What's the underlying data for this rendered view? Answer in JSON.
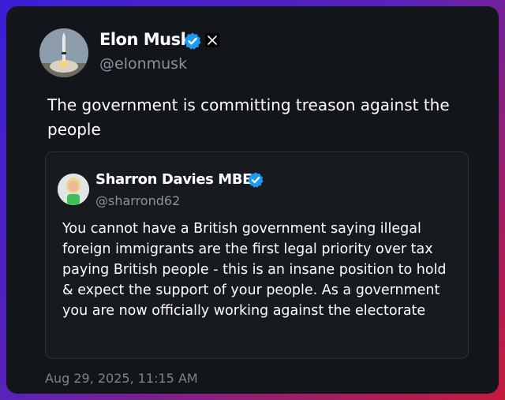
{
  "post": {
    "author": {
      "name": "Elon Musk",
      "handle": "@elonmusk",
      "verified": true,
      "platform_icon": "x-logo-icon"
    },
    "text": "The government is committing treason against the people",
    "timestamp": "Aug 29, 2025, 11:15 AM"
  },
  "quoted_post": {
    "author": {
      "name": "Sharron Davies MBE",
      "handle": "@sharrond62",
      "verified": true
    },
    "text": "You cannot have a British government saying illegal foreign  immigrants are the first legal priority over tax paying British people - this is an insane position to hold & expect the support of your people. As a government you are now officially working against the electorate"
  },
  "colors": {
    "card_bg": "#121519",
    "quote_bg": "#171b20",
    "verified_blue": "#1d9bf0",
    "muted_text": "#8b929b",
    "frame_gradient_start": "#3a1fd6",
    "frame_gradient_end": "#c41a3c"
  }
}
